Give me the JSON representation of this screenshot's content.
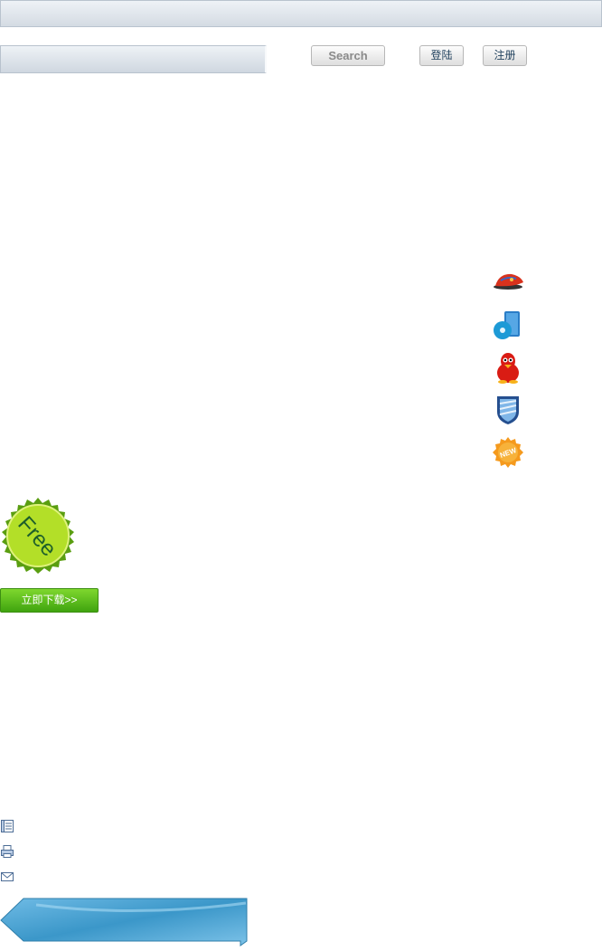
{
  "header": {},
  "search": {
    "value": "",
    "placeholder": "",
    "button_label": "Search"
  },
  "auth": {
    "login_label": "登陆",
    "register_label": "注册"
  },
  "side_icons": [
    {
      "icon": "red-cap-icon"
    },
    {
      "icon": "music-disc-icon"
    },
    {
      "icon": "qq-penguin-icon"
    },
    {
      "icon": "shield-icon"
    },
    {
      "icon": "new-badge-icon",
      "text": "NEW"
    }
  ],
  "promo": {
    "badge_text": "Free",
    "download_label": "立即下载>>"
  },
  "footer_icons": [
    {
      "icon": "list-icon"
    },
    {
      "icon": "printer-icon"
    },
    {
      "icon": "mail-icon"
    }
  ],
  "colors": {
    "topbar": "#d4dbe3",
    "badge_green": "#9ad21a",
    "download_green": "#4fb81a",
    "arrow_blue": "#3b97c9"
  }
}
